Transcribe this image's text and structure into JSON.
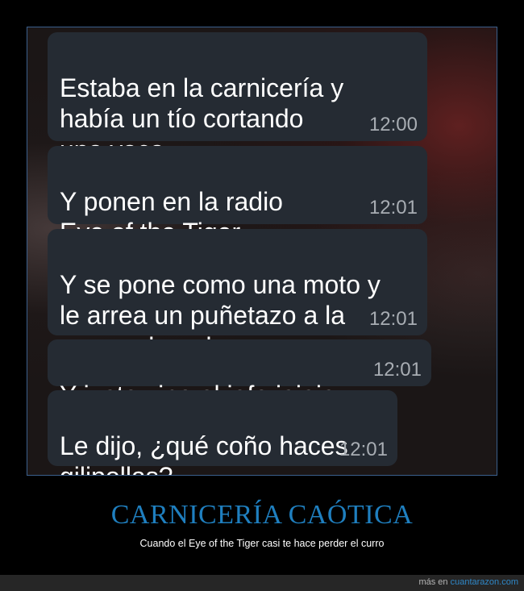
{
  "messages": [
    {
      "text": "Estaba en la carnicería y\nhabía un tío cortando\nuna vaca",
      "time": "12:00"
    },
    {
      "text": "Y ponen en la radio\nEye of the Tiger",
      "time": "12:01"
    },
    {
      "text": "Y se pone como una moto y\nle arrea un puñetazo a la\nvaca colgando",
      "time": "12:01"
    },
    {
      "text": "Y justo vino el jefe jajaja",
      "time": "12:01"
    },
    {
      "text": "Le dijo, ¿qué coño haces\ngilipollas?",
      "time": "12:01"
    }
  ],
  "title": "CARNICERÍA CAÓTICA",
  "subtitle": "Cuando el Eye of the Tiger casi te hace perder el curro",
  "footer": {
    "prefix": "más en",
    "link": "cuantarazon.com"
  },
  "colors": {
    "bubble": "#252b33",
    "title": "#1f7fbf",
    "link": "#2f87c7"
  }
}
